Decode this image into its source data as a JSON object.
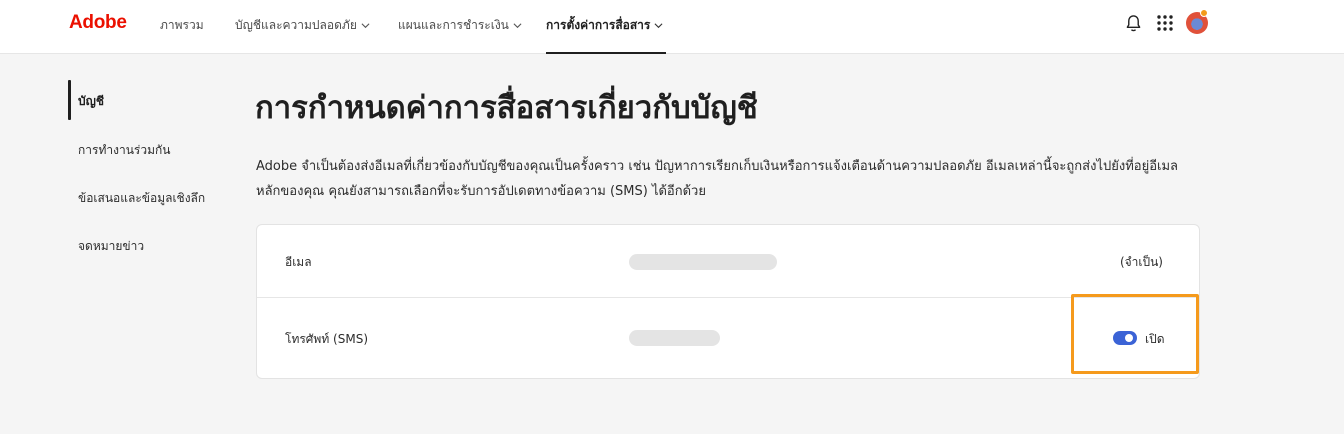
{
  "header": {
    "logo": "Adobe",
    "nav": [
      {
        "label": "ภาพรวม",
        "has_dropdown": false
      },
      {
        "label": "บัญชีและความปลอดภัย",
        "has_dropdown": true
      },
      {
        "label": "แผนและการชำระเงิน",
        "has_dropdown": true
      },
      {
        "label": "การตั้งค่าการสื่อสาร",
        "has_dropdown": true,
        "active": true
      }
    ],
    "icons": [
      "bell-icon",
      "apps-grid-icon",
      "avatar"
    ]
  },
  "sidebar": {
    "items": [
      {
        "label": "บัญชี",
        "active": true
      },
      {
        "label": "การทำงานร่วมกัน"
      },
      {
        "label": "ข้อเสนอและข้อมูลเชิงลึก"
      },
      {
        "label": "จดหมายข่าว"
      }
    ]
  },
  "main": {
    "title": "การกำหนดค่าการสื่อสารเกี่ยวกับบัญชี",
    "description": "Adobe จำเป็นต้องส่งอีเมลที่เกี่ยวข้องกับบัญชีของคุณเป็นครั้งคราว เช่น ปัญหาการเรียกเก็บเงินหรือการแจ้งเตือนด้านความปลอดภัย อีเมลเหล่านี้จะถูกส่งไปยังที่อยู่อีเมลหลักของคุณ คุณยังสามารถเลือกที่จะรับการอัปเดตทางข้อความ (SMS) ได้อีกด้วย",
    "rows": [
      {
        "label": "อีเมล",
        "status": "(จำเป็น)"
      },
      {
        "label": "โทรศัพท์ (SMS)",
        "toggle_label": "เปิด",
        "toggle_on": true
      }
    ]
  },
  "colors": {
    "brand": "#eb1000",
    "toggle_on": "#3b63d6",
    "highlight": "#f59a1c"
  }
}
